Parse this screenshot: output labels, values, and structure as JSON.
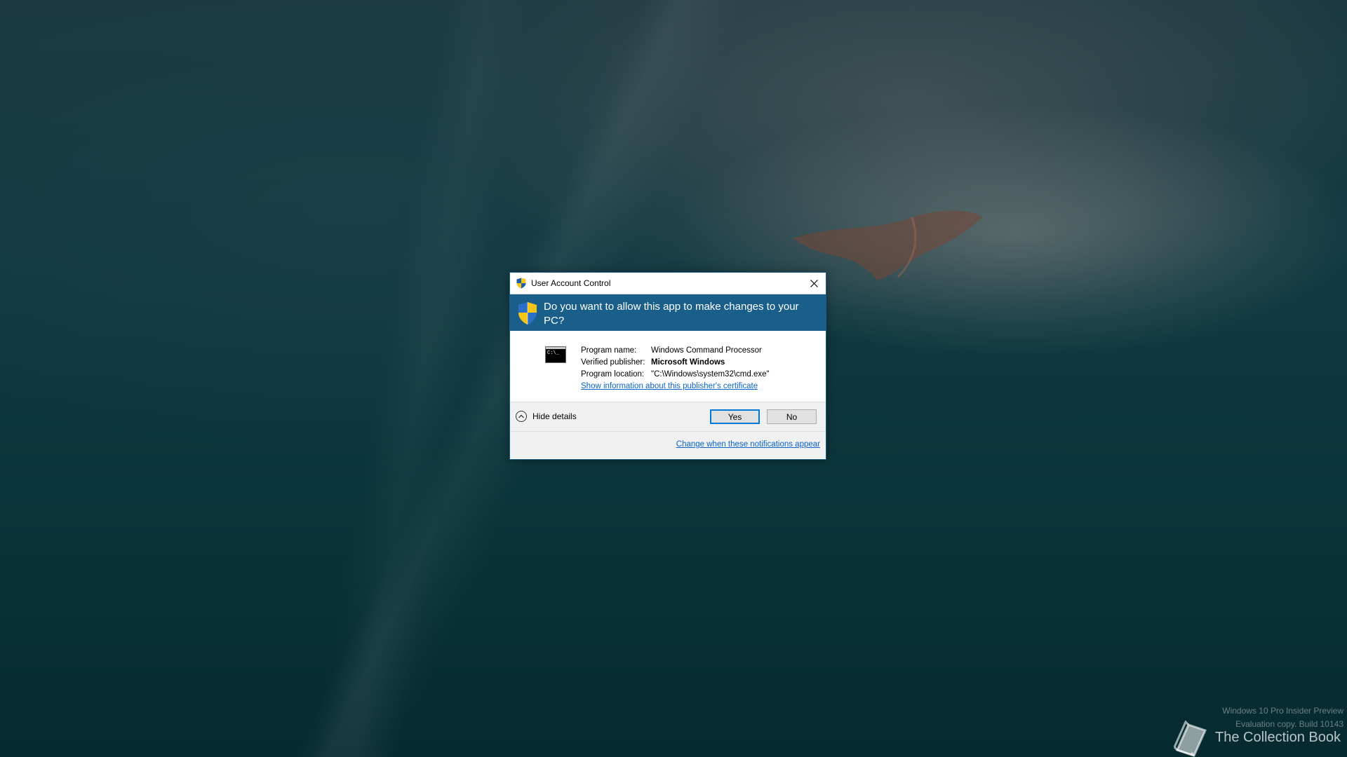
{
  "dialog": {
    "title": "User Account Control",
    "question": "Do you want to allow this app to make changes to your PC?",
    "program_name_label": "Program name:",
    "program_name": "Windows Command Processor",
    "publisher_label": "Verified publisher:",
    "publisher": "Microsoft Windows",
    "location_label": "Program location:",
    "location": "\"C:\\Windows\\system32\\cmd.exe\"",
    "certificate_link": "Show information about this publisher's certificate",
    "hide_details": "Hide details",
    "yes_label": "Yes",
    "no_label": "No",
    "notifications_link": "Change when these notifications appear",
    "cmd_icon_text": "C:\\_"
  },
  "desktop": {
    "watermark_line1": "Windows 10 Pro Insider Preview",
    "watermark_line2": "Evaluation copy. Build 10143",
    "logo_text": "The Collection Book"
  },
  "colors": {
    "banner": "#1a5f8a",
    "link": "#0a64c8",
    "button_focus": "#0078d7"
  },
  "icons": [
    "uac-shield-icon",
    "close-icon",
    "cmd-program-icon",
    "chevron-up-icon",
    "book-icon"
  ]
}
